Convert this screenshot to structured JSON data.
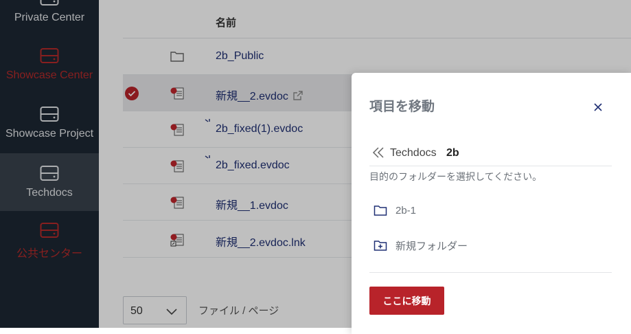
{
  "sidebar": {
    "items": [
      {
        "label": "Private Center",
        "icon": "drive-icon",
        "color": "#e5e7ea"
      },
      {
        "label": "Showcase Center",
        "icon": "drive-icon",
        "color": "#b42a2a"
      },
      {
        "label": "Showcase Project",
        "icon": "drive-icon",
        "color": "#e5e7ea"
      },
      {
        "label": "Techdocs",
        "icon": "drive-icon",
        "color": "#e5e7ea",
        "active": true
      },
      {
        "label": "公共センター",
        "icon": "drive-icon",
        "color": "#b42a2a"
      }
    ]
  },
  "table": {
    "column_name": "名前",
    "rows": [
      {
        "name": "2b_Public",
        "type": "folder"
      },
      {
        "name": "新規__2.evdoc",
        "type": "evdoc",
        "selected": true,
        "external_link": true
      },
      {
        "name": "2b_fixed(1).evdoc",
        "type": "evdoc"
      },
      {
        "name": "2b_fixed.evdoc",
        "type": "evdoc"
      },
      {
        "name": "新規__1.evdoc",
        "type": "evdoc"
      },
      {
        "name": "新規__2.evdoc.lnk",
        "type": "evdoc-link"
      }
    ]
  },
  "pagination": {
    "page_size": "50",
    "per_page_label": "ファイル / ページ"
  },
  "modal": {
    "title": "項目を移動",
    "breadcrumb": {
      "parent": "Techdocs",
      "current": "2b"
    },
    "hint": "目的のフォルダーを選択してください。",
    "targets": [
      {
        "label": "2b-1",
        "icon": "folder-icon"
      },
      {
        "label": "新規フォルダー",
        "icon": "new-folder-icon"
      }
    ],
    "move_button": "ここに移動"
  },
  "colors": {
    "accent": "#b8232a",
    "sidebar": "#1d2733",
    "link": "#1f2f73"
  }
}
